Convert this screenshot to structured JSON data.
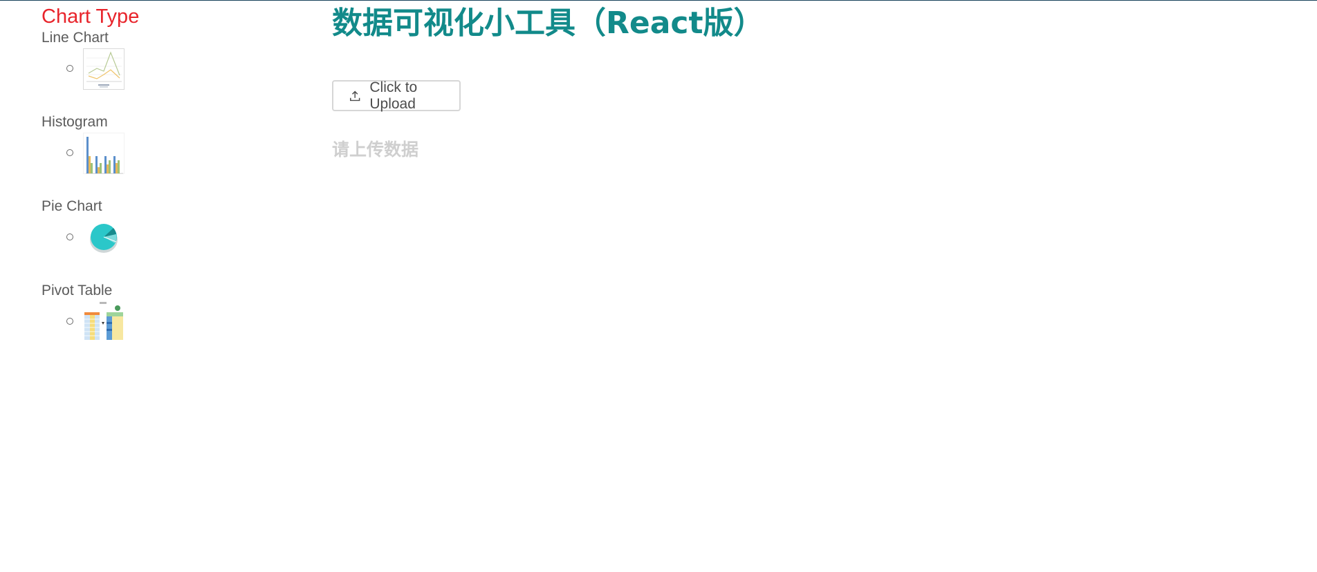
{
  "colors": {
    "sidebar_title": "#e8242b",
    "page_title": "#128a8a",
    "top_line": "#17425a"
  },
  "sidebar": {
    "title": "Chart Type",
    "items": [
      {
        "label": "Line Chart",
        "thumbnail_icon": "line-chart-thumbnail-icon"
      },
      {
        "label": "Histogram",
        "thumbnail_icon": "histogram-thumbnail-icon"
      },
      {
        "label": "Pie Chart",
        "thumbnail_icon": "pie-chart-thumbnail-icon"
      },
      {
        "label": "Pivot Table",
        "thumbnail_icon": "pivot-table-thumbnail-icon"
      }
    ]
  },
  "main": {
    "title": "数据可视化小工具（React版）",
    "upload_button": {
      "label": "Click to Upload",
      "icon": "upload-icon"
    },
    "empty_hint": "请上传数据"
  }
}
